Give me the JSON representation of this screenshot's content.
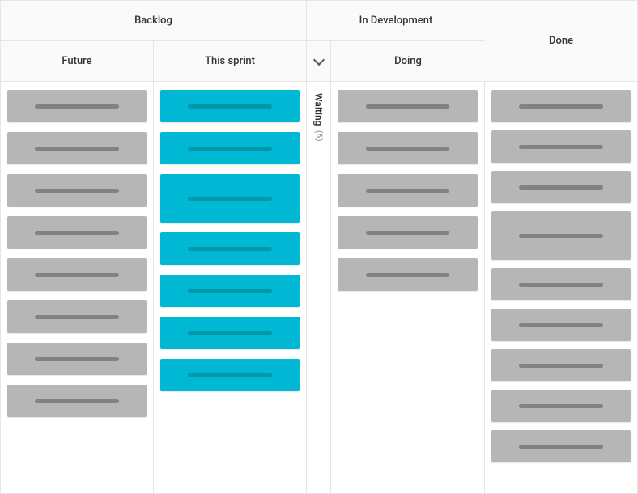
{
  "headers": {
    "backlog": "Backlog",
    "in_development": "In Development",
    "done": "Done",
    "future": "Future",
    "this_sprint": "This sprint",
    "doing": "Doing",
    "waiting": "Waiting",
    "waiting_count": "6"
  },
  "columns": {
    "future": {
      "cards": [
        {
          "variant": ""
        },
        {
          "variant": ""
        },
        {
          "variant": ""
        },
        {
          "variant": ""
        },
        {
          "variant": ""
        },
        {
          "variant": ""
        },
        {
          "variant": ""
        },
        {
          "variant": ""
        }
      ]
    },
    "this_sprint": {
      "cards": [
        {
          "variant": "highlight"
        },
        {
          "variant": "highlight"
        },
        {
          "variant": "highlight tall"
        },
        {
          "variant": "highlight"
        },
        {
          "variant": "highlight"
        },
        {
          "variant": "highlight"
        },
        {
          "variant": "highlight"
        }
      ]
    },
    "doing": {
      "cards": [
        {
          "variant": ""
        },
        {
          "variant": ""
        },
        {
          "variant": ""
        },
        {
          "variant": ""
        },
        {
          "variant": ""
        }
      ]
    },
    "done": {
      "cards": [
        {
          "variant": ""
        },
        {
          "variant": ""
        },
        {
          "variant": ""
        },
        {
          "variant": "tall"
        },
        {
          "variant": ""
        },
        {
          "variant": ""
        },
        {
          "variant": ""
        },
        {
          "variant": ""
        },
        {
          "variant": ""
        }
      ]
    }
  }
}
